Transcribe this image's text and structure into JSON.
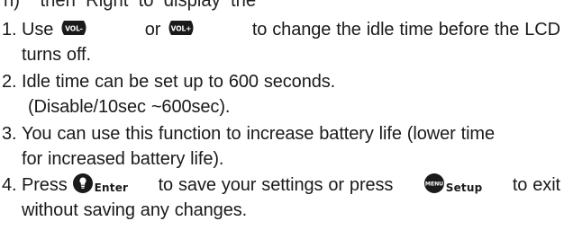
{
  "top_fragment": "n)    then  Right  to  display  the",
  "steps": [
    {
      "num": "1.",
      "t1": "Use",
      "t2": "or",
      "t3": "to change the idle time before the LCD",
      "t4": "turns off.",
      "icons": [
        "vol-minus-icon",
        "vol-plus-icon"
      ]
    },
    {
      "num": "2.",
      "t1": "Idle time can be set up to 600 seconds.",
      "t2": "(Disable/10sec ~600sec)."
    },
    {
      "num": "3.",
      "t1": "You can use this function to increase battery life (lower time",
      "t2": "for increased battery life)."
    },
    {
      "num": "4.",
      "t1": "Press",
      "enter_label": "Enter",
      "t2": "to save your settings or press",
      "setup_label": "Setup",
      "t3": "to exit",
      "t4": "without saving any changes.",
      "icons": [
        "enter-button-icon",
        "menu-button-icon"
      ]
    }
  ],
  "icon_glyphs": {
    "vol_minus": "VOL-",
    "vol_plus": "VOL+",
    "menu": "MENU"
  }
}
